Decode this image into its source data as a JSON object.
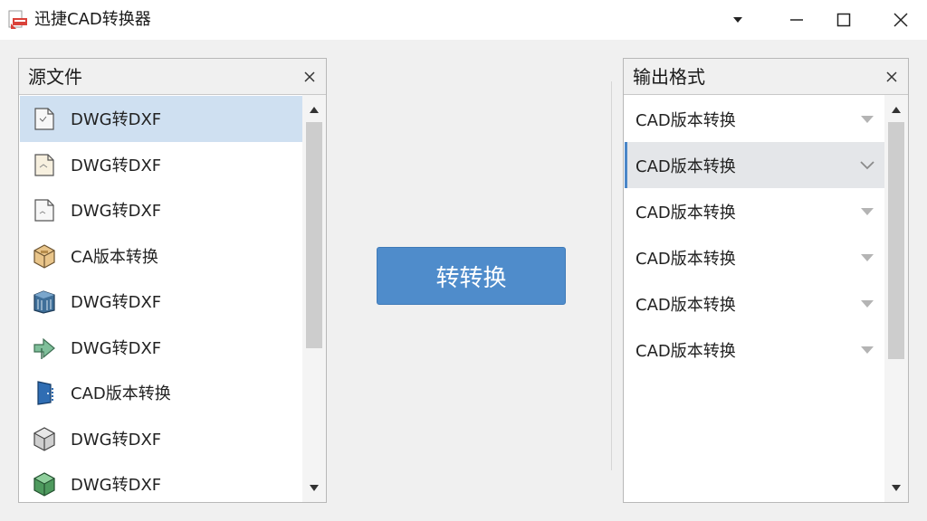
{
  "window": {
    "title": "迅捷CAD转换器",
    "dropdown_glyph": "▾",
    "minimize_glyph": "—",
    "maximize_glyph": "☐",
    "close_glyph": "✕"
  },
  "source_panel": {
    "title": "源文件",
    "close_glyph": "×",
    "files": [
      {
        "label": "DWG转DXF",
        "icon": "document-icon",
        "selected": true
      },
      {
        "label": "DWG转DXF",
        "icon": "document-icon",
        "selected": false
      },
      {
        "label": "DWG转DXF",
        "icon": "document-icon",
        "selected": false
      },
      {
        "label": "CA版本转换",
        "icon": "box-icon",
        "selected": false
      },
      {
        "label": "DWG转DXF",
        "icon": "building-icon",
        "selected": false
      },
      {
        "label": "DWG转DXF",
        "icon": "arrow-icon",
        "selected": false
      },
      {
        "label": "CAD版本转换",
        "icon": "door-icon",
        "selected": false
      },
      {
        "label": "DWG转DXF",
        "icon": "cube-icon",
        "selected": false
      },
      {
        "label": "DWG转DXF",
        "icon": "green-cube-icon",
        "selected": false
      }
    ]
  },
  "convert_button": {
    "label": "转转换"
  },
  "output_panel": {
    "title": "输出格式",
    "close_glyph": "×",
    "formats": [
      {
        "label": "CAD版本转换",
        "selected": false
      },
      {
        "label": "CAD版本转换",
        "selected": true
      },
      {
        "label": "CAD版本转换",
        "selected": false
      },
      {
        "label": "CAD版本转换",
        "selected": false
      },
      {
        "label": "CAD版本转换",
        "selected": false
      },
      {
        "label": "CAD版本转换",
        "selected": false
      }
    ]
  },
  "colors": {
    "accent": "#4f8ccb",
    "selection": "#cfe0f1",
    "window_bg": "#f0f0f0"
  }
}
